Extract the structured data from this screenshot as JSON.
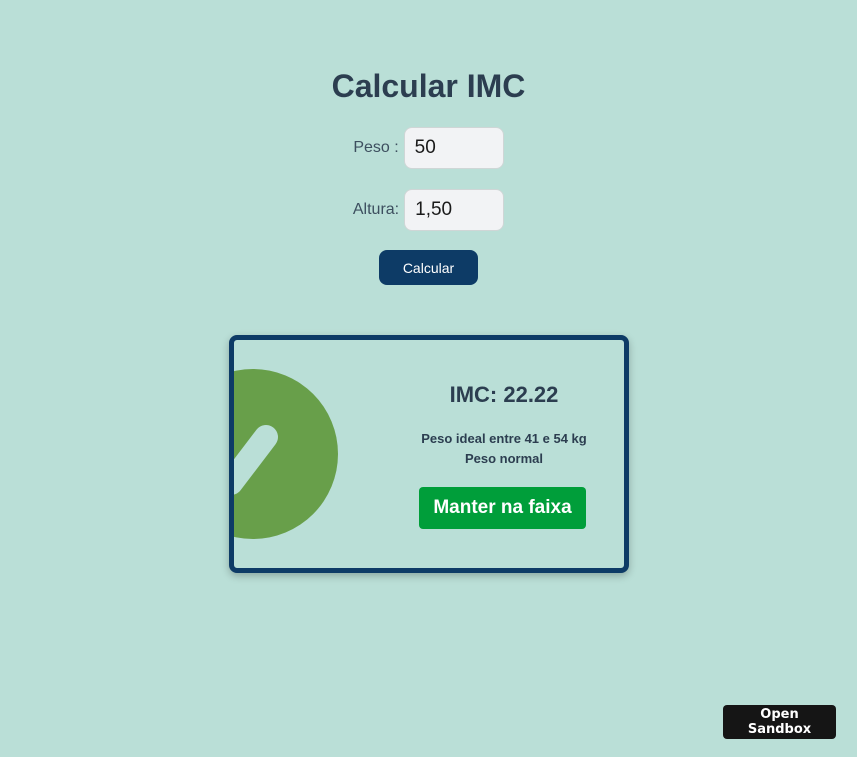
{
  "header": {
    "title": "Calcular IMC"
  },
  "form": {
    "peso": {
      "label": "Peso :",
      "value": "50"
    },
    "altura": {
      "label": "Altura:",
      "value": "1,50"
    },
    "calc_label": "Calcular"
  },
  "result": {
    "imc_text": "IMC: 22.22",
    "ideal_text": "Peso ideal entre 41 e 54 kg",
    "status_text": "Peso normal",
    "advice_label": "Manter na faixa",
    "icon": "check-circle-icon"
  },
  "sandbox": {
    "label": "Open Sandbox"
  },
  "colors": {
    "background": "#badfd7",
    "primary": "#0d3b66",
    "success": "#009e3a",
    "check_circle": "#689f4a"
  }
}
